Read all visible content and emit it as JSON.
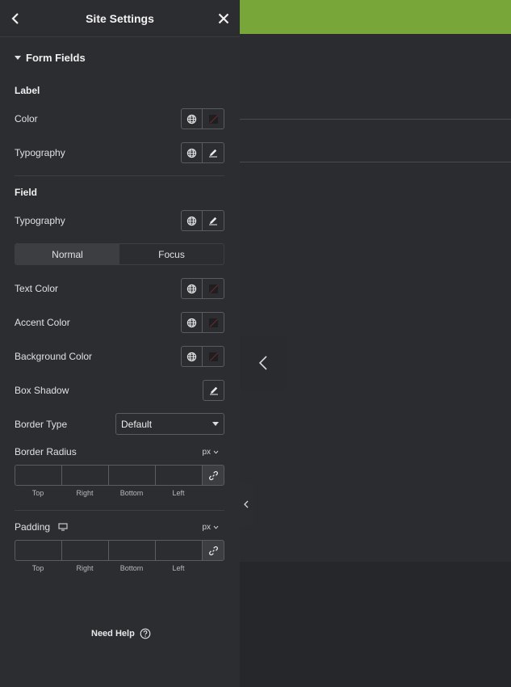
{
  "header": {
    "title": "Site Settings"
  },
  "section": {
    "title": "Form Fields"
  },
  "label_group": {
    "heading": "Label",
    "color_label": "Color",
    "typography_label": "Typography"
  },
  "field_group": {
    "heading": "Field",
    "typography_label": "Typography",
    "tabs": [
      "Normal",
      "Focus"
    ],
    "text_color_label": "Text Color",
    "accent_color_label": "Accent Color",
    "background_color_label": "Background Color",
    "box_shadow_label": "Box Shadow",
    "border_type_label": "Border Type",
    "border_type_value": "Default",
    "border_radius_label": "Border Radius",
    "border_radius_unit": "px",
    "padding_label": "Padding",
    "padding_unit": "px",
    "dimension_labels": [
      "Top",
      "Right",
      "Bottom",
      "Left"
    ]
  },
  "help": {
    "label": "Need Help"
  },
  "colors": {
    "brand_bar": "#78a639",
    "panel": "#2c2d30"
  }
}
